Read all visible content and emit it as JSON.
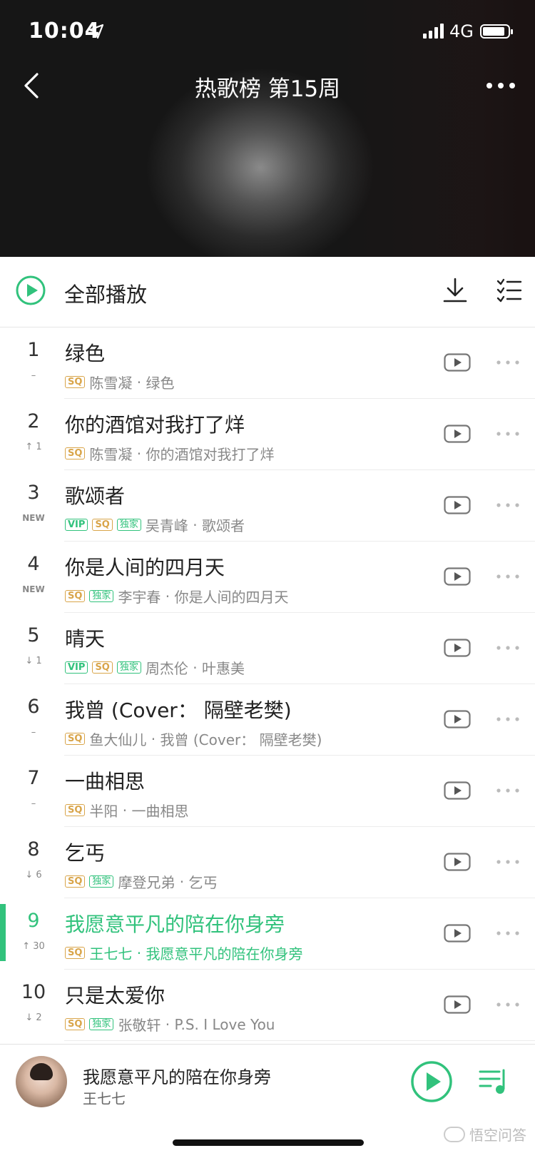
{
  "status": {
    "time": "10:04",
    "network": "4G"
  },
  "header": {
    "title": "热歌榜 第15周"
  },
  "playall": {
    "label": "全部播放"
  },
  "songs": [
    {
      "rank": "1",
      "trend": "–",
      "title": "绿色",
      "tags": [
        "SQ"
      ],
      "artist": "陈雪凝",
      "album": "绿色"
    },
    {
      "rank": "2",
      "trend": "↑ 1",
      "title": "你的酒馆对我打了烊",
      "tags": [
        "SQ"
      ],
      "artist": "陈雪凝",
      "album": "你的酒馆对我打了烊"
    },
    {
      "rank": "3",
      "trend": "NEW",
      "title": "歌颂者",
      "tags": [
        "VIP",
        "SQ",
        "独家"
      ],
      "artist": "吴青峰",
      "album": "歌颂者"
    },
    {
      "rank": "4",
      "trend": "NEW",
      "title": "你是人间的四月天",
      "tags": [
        "SQ",
        "独家"
      ],
      "artist": "李宇春",
      "album": "你是人间的四月天"
    },
    {
      "rank": "5",
      "trend": "↓ 1",
      "title": "晴天",
      "tags": [
        "VIP",
        "SQ",
        "独家"
      ],
      "artist": "周杰伦",
      "album": "叶惠美"
    },
    {
      "rank": "6",
      "trend": "–",
      "title": "我曾 (Cover： 隔壁老樊)",
      "tags": [
        "SQ"
      ],
      "artist": "鱼大仙儿",
      "album": "我曾 (Cover： 隔壁老樊)"
    },
    {
      "rank": "7",
      "trend": "–",
      "title": "一曲相思",
      "tags": [
        "SQ"
      ],
      "artist": "半阳",
      "album": "一曲相思"
    },
    {
      "rank": "8",
      "trend": "↓ 6",
      "title": "乞丐",
      "tags": [
        "SQ",
        "独家"
      ],
      "artist": "摩登兄弟",
      "album": "乞丐"
    },
    {
      "rank": "9",
      "trend": "↑ 30",
      "title": "我愿意平凡的陪在你身旁",
      "tags": [
        "SQ"
      ],
      "artist": "王七七",
      "album": "我愿意平凡的陪在你身旁",
      "active": true
    },
    {
      "rank": "10",
      "trend": "↓ 2",
      "title": "只是太爱你",
      "tags": [
        "SQ",
        "独家"
      ],
      "artist": "张敬轩",
      "album": "P.S. I Love You"
    }
  ],
  "player": {
    "title": "我愿意平凡的陪在你身旁",
    "artist": "王七七"
  },
  "watermark": "悟空问答",
  "colors": {
    "accent": "#31c27c",
    "sq": "#d9a54a"
  },
  "icons": [
    "back-icon",
    "more-icon",
    "play-circle-icon",
    "download-icon",
    "multiselect-icon",
    "mv-icon",
    "playlist-icon"
  ]
}
